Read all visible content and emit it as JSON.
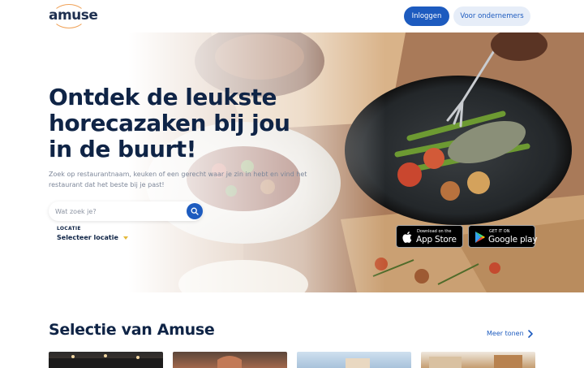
{
  "header": {
    "logo_text": "amuse",
    "login_label": "Inloggen",
    "business_label": "Voor ondernemers"
  },
  "hero": {
    "title": "Ontdek de leukste horecazaken bij jou in de buurt!",
    "subtitle": "Zoek op restaurantnaam, keuken of een gerecht waar je zin in hebt en vind het restaurant dat het beste bij je past!",
    "search": {
      "placeholder": "Wat zoek je?",
      "value": ""
    },
    "location": {
      "label": "LOCATIE",
      "selected": "Selecteer locatie"
    },
    "app_store": {
      "small": "Download on the",
      "big": "App Store"
    },
    "google_play": {
      "small": "GET IT ON",
      "big": "Google play"
    }
  },
  "selection": {
    "title": "Selectie van Amuse",
    "more_label": "Meer tonen",
    "cards": [
      {
        "icon": "restaurant-photo"
      },
      {
        "icon": "restaurant-photo"
      },
      {
        "icon": "restaurant-photo"
      },
      {
        "icon": "restaurant-photo"
      }
    ]
  },
  "colors": {
    "primary": "#1d5bbf",
    "navy": "#0f2446",
    "secondary_button_bg": "#e6edf8",
    "logo_accent": "#f0a35a"
  }
}
